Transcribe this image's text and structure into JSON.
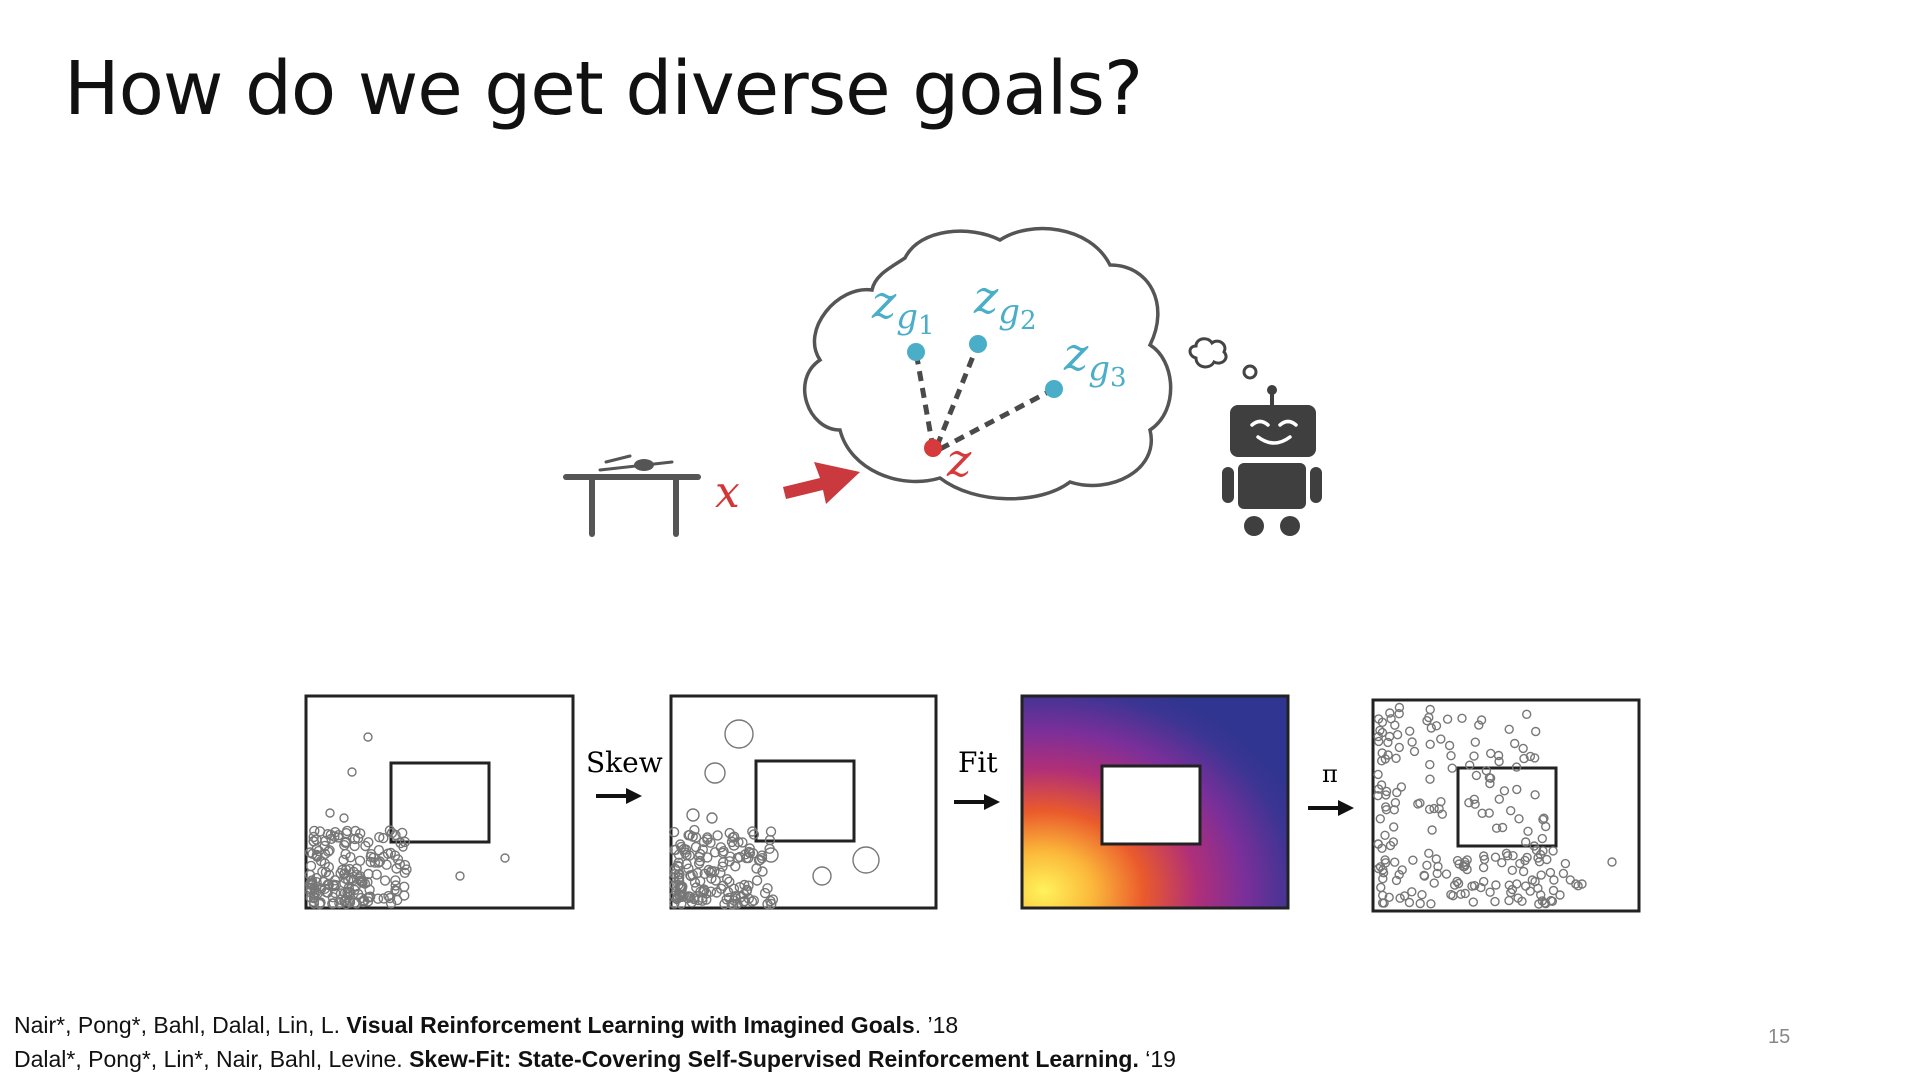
{
  "slide": {
    "title": "How do we get diverse goals?",
    "page_number": "15"
  },
  "cloud_diagram": {
    "input_label": "x",
    "latent_label": "z",
    "goals": [
      {
        "base": "z",
        "sub": "g",
        "index": "1"
      },
      {
        "base": "z",
        "sub": "g",
        "index": "2"
      },
      {
        "base": "z",
        "sub": "g",
        "index": "3"
      }
    ],
    "colors": {
      "goal": "#4aaec8",
      "latent": "#d63a3a",
      "arrow": "#c9393d",
      "robot": "#3f3f3f"
    }
  },
  "pipeline": {
    "steps": [
      "Skew",
      "Fit",
      "π"
    ],
    "panels": [
      "samples",
      "skewed-samples",
      "fitted-density",
      "policy-samples"
    ]
  },
  "references": [
    {
      "authors": "Nair*, Pong*, Bahl, Dalal, Lin, L. ",
      "title": "Visual Reinforcement Learning with Imagined Goals",
      "year": ". ’18"
    },
    {
      "authors": "Dalal*, Pong*, Lin*, Nair, Bahl, Levine. ",
      "title": "Skew-Fit: State-Covering Self-Supervised Reinforcement Learning.",
      "year": " ‘19"
    }
  ]
}
